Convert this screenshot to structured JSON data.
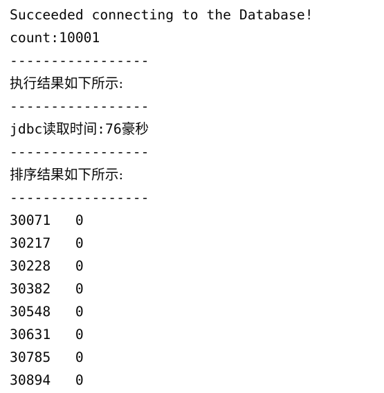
{
  "console": {
    "connect_msg": "Succeeded connecting to the Database!",
    "count_line": "count:10001",
    "separator": "-----------------",
    "exec_result_label": "执行结果如下所示:",
    "jdbc_prefix": "jdbc",
    "jdbc_read_label": "读取时间",
    "jdbc_time_value": ":76",
    "jdbc_unit": "豪秒",
    "sort_result_label": "排序结果如下所示:",
    "rows": [
      {
        "id": "30071",
        "value": "0"
      },
      {
        "id": "30217",
        "value": "0"
      },
      {
        "id": "30228",
        "value": "0"
      },
      {
        "id": "30382",
        "value": "0"
      },
      {
        "id": "30548",
        "value": "0"
      },
      {
        "id": "30631",
        "value": "0"
      },
      {
        "id": "30785",
        "value": "0"
      },
      {
        "id": "30894",
        "value": "0"
      }
    ]
  }
}
